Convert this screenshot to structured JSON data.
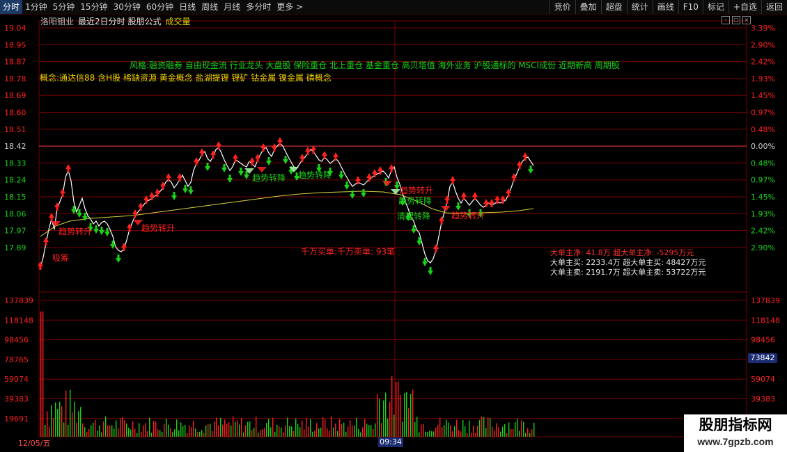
{
  "topbar": {
    "periods": [
      "分时",
      "1分钟",
      "5分钟",
      "15分钟",
      "30分钟",
      "60分钟",
      "日线",
      "周线",
      "月线",
      "多分时",
      "更多 >"
    ],
    "active_index": 0,
    "tools": [
      "竞价",
      "叠加",
      "超盘",
      "统计",
      "画线",
      "F10",
      "标记",
      "+自选",
      "返回"
    ]
  },
  "header": {
    "stock_name": "洛阳钼业",
    "formula": "最近2日分时 股朋公式",
    "volume_label": "成交量"
  },
  "concepts": {
    "style": "风格:融资融券 自由现金流 行业龙头 大盘股 保险重仓 北上重仓 基金重仓 高贝塔值 海外业务 沪股通标的 MSCI成份 近期新高 周期股",
    "concept": "概念:通达信88 含H股 稀缺资源 黄金概念 盐湖提锂 锂矿 钴金属 镍金属 磷概念"
  },
  "price_axis": {
    "left": [
      "19.04",
      "18.95",
      "18.87",
      "18.78",
      "18.69",
      "18.60",
      "18.51",
      "18.42",
      "18.33",
      "18.24",
      "18.15",
      "18.06",
      "17.97",
      "17.89"
    ],
    "right": [
      "3.39%",
      "2.90%",
      "2.42%",
      "1.93%",
      "1.45%",
      "0.97%",
      "0.48%",
      "0.00%",
      "0.48%",
      "0.97%",
      "1.45%",
      "1.93%",
      "2.42%",
      "2.90%"
    ]
  },
  "volume_axis": [
    "137839",
    "118148",
    "98456",
    "78765",
    "59074",
    "39383",
    "19691"
  ],
  "volume_current": "73842",
  "annotations": {
    "trend_up": "趋势转升",
    "trend_down": "趋势转降",
    "absorb": "吸筹",
    "clean_down": "清理转降",
    "million_trades": "千万买单:千万卖单: 93笔"
  },
  "big_orders": {
    "net_line": "大单主净: 41.8万  超大单主净: -5295万元",
    "buy_line": "大单主买: 2233.4万  超大单主买: 48427万元",
    "sell_line": "大单主卖: 2191.7万  超大单主卖: 53722万元"
  },
  "footer": {
    "date": "12/05/五",
    "time": "09:34"
  },
  "watermark": {
    "title": "股朋指标网",
    "url": "www.7gpzb.com"
  },
  "colors": {
    "up": "#ff2020",
    "down": "#19d219",
    "price_line": "#ffffff",
    "avg_line": "#d8d040",
    "grid": "#7a0000"
  }
}
